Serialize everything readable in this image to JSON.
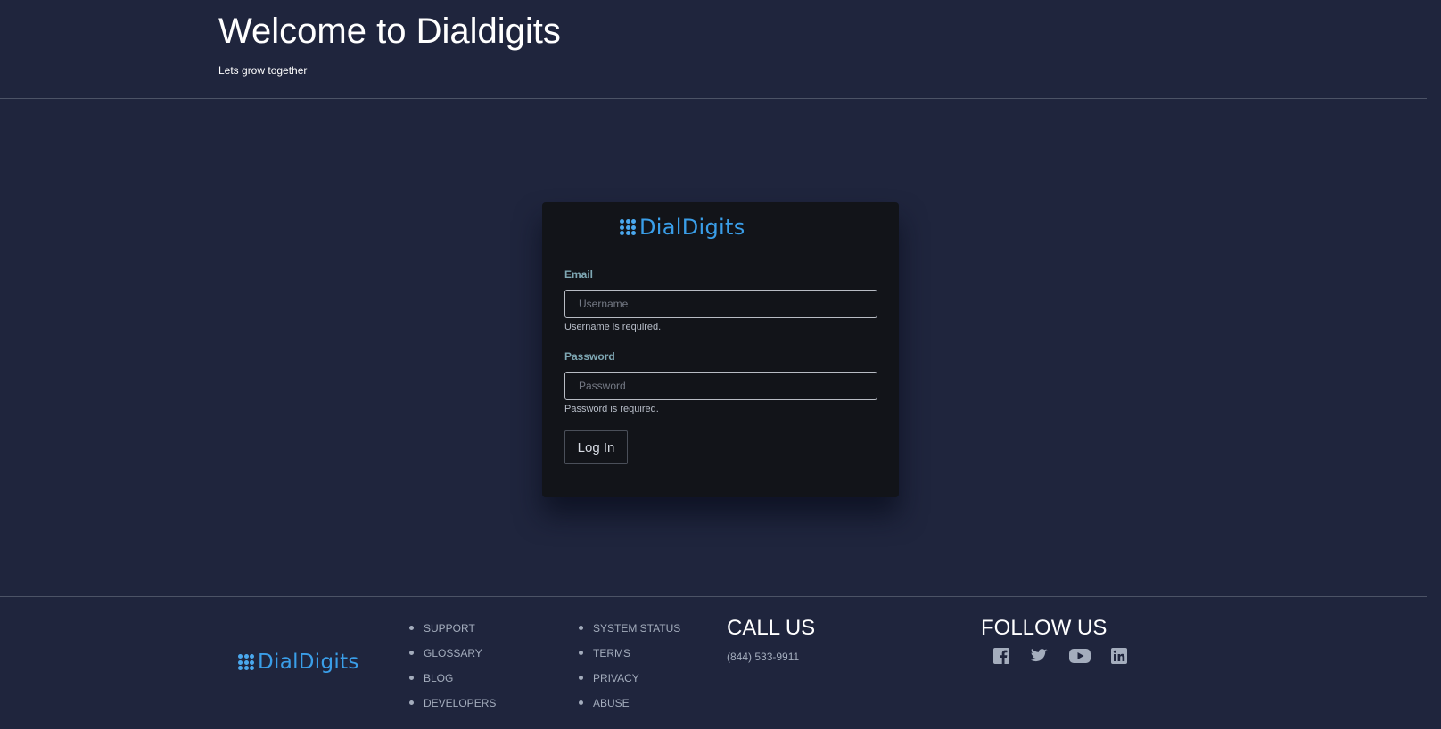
{
  "header": {
    "title": "Welcome to Dialdigits",
    "subtitle": "Lets grow together"
  },
  "login": {
    "logo_text_dial": "Dial",
    "logo_text_digits": "Digits",
    "email_label": "Email",
    "email_placeholder": "Username",
    "email_value": "",
    "email_error": "Username is required.",
    "password_label": "Password",
    "password_placeholder": "Password",
    "password_value": "",
    "password_error": "Password is required.",
    "login_button": "Log In"
  },
  "footer": {
    "logo_text_dial": "Dial",
    "logo_text_digits": "Digits",
    "links_col1": [
      "SUPPORT",
      "GLOSSARY",
      "BLOG",
      "DEVELOPERS"
    ],
    "links_col2": [
      "SYSTEM STATUS",
      "TERMS",
      "PRIVACY",
      "ABUSE"
    ],
    "call_heading": "CALL US",
    "phone": "(844) 533-9911",
    "follow_heading": "FOLLOW US",
    "social_icons": [
      "facebook-icon",
      "twitter-icon",
      "youtube-icon",
      "linkedin-icon"
    ]
  },
  "colors": {
    "background": "#1f253d",
    "card": "#121419",
    "brand_blue": "#3a9ee8",
    "label_teal": "#7fa8b4",
    "footer_link": "#a4adbd"
  }
}
